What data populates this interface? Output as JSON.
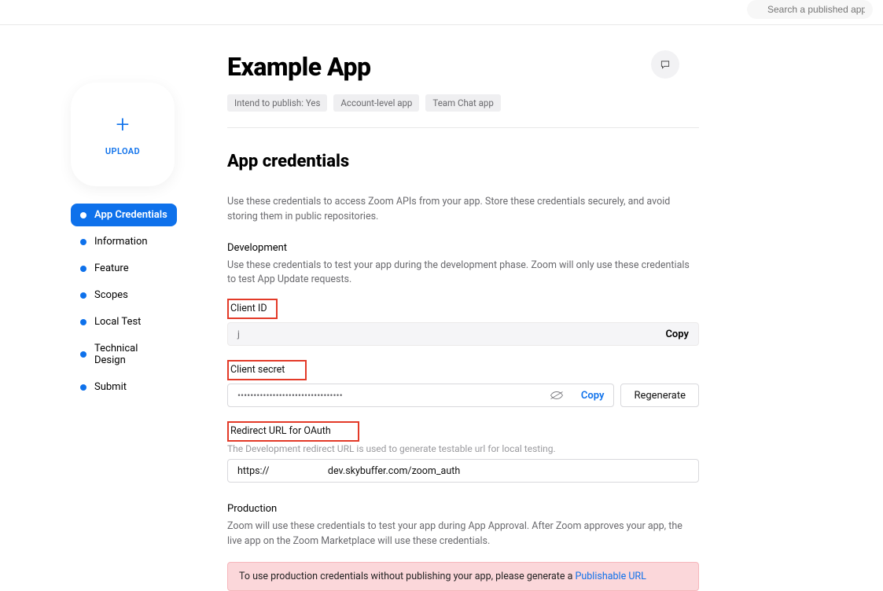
{
  "search": {
    "placeholder": "Search a published app"
  },
  "upload": {
    "label": "UPLOAD"
  },
  "nav": {
    "items": [
      {
        "label": "App Credentials",
        "active": true
      },
      {
        "label": "Information"
      },
      {
        "label": "Feature"
      },
      {
        "label": "Scopes"
      },
      {
        "label": "Local Test"
      },
      {
        "label": "Technical Design"
      },
      {
        "label": "Submit"
      }
    ]
  },
  "app": {
    "title": "Example App",
    "tags": [
      "Intend to publish: Yes",
      "Account-level app",
      "Team Chat app"
    ]
  },
  "credentials": {
    "section_title": "App credentials",
    "section_desc": "Use these credentials to access Zoom APIs from your app. Store these credentials securely, and avoid storing them in public repositories.",
    "dev": {
      "heading": "Development",
      "desc": "Use these credentials to test your app during the development phase. Zoom will only use these credentials to test App Update requests.",
      "client_id_label": "Client ID",
      "client_id_value": "j",
      "copy_label": "Copy",
      "client_secret_label": "Client secret",
      "client_secret_masked": "•••••••••••••••••••••••••••••••••",
      "regen_label": "Regenerate",
      "redirect_label": "Redirect URL for OAuth",
      "redirect_help": "The Development redirect URL is used to generate testable url for local testing.",
      "redirect_value_prefix": "https://",
      "redirect_value_suffix": "dev.skybuffer.com/zoom_auth"
    },
    "prod": {
      "heading": "Production",
      "desc": "Zoom will use these credentials to test your app during App Approval. After Zoom approves your app, the live app on the Zoom Marketplace will use these credentials.",
      "alert_text": "To use production credentials without publishing your app, please generate a ",
      "alert_link": "Publishable URL"
    }
  }
}
